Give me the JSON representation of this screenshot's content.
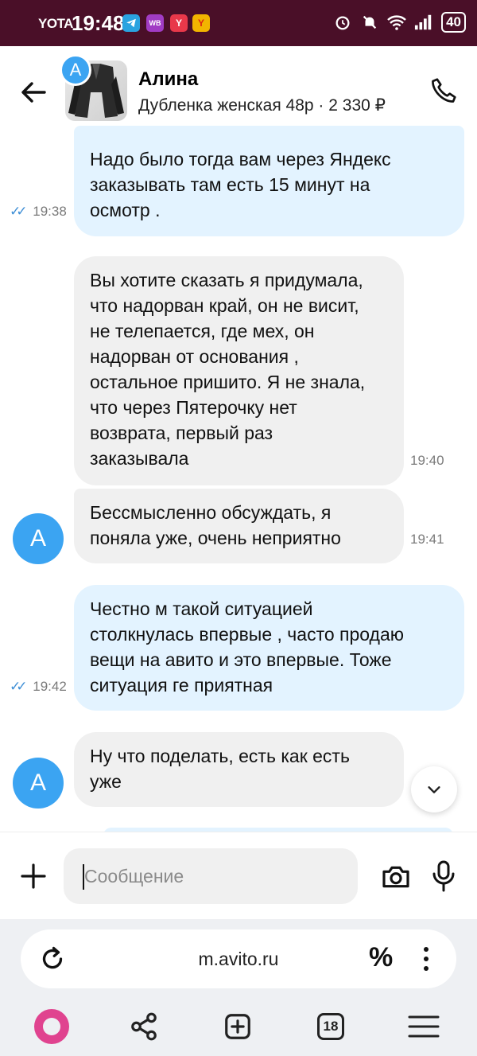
{
  "status_bar": {
    "carrier": "YOTA",
    "time": "19:48",
    "app_icons": [
      {
        "name": "telegram-icon",
        "label": "",
        "color": "#2aa3e0"
      },
      {
        "name": "wildberries-icon",
        "label": "WB",
        "color": "#a13cc4"
      },
      {
        "name": "yandex-icon",
        "label": "Y",
        "color": "#e8384a"
      },
      {
        "name": "yandex-market-icon",
        "label": "Y",
        "color": "#f2b400"
      }
    ],
    "battery": "40"
  },
  "header": {
    "contact_name": "Алина",
    "avatar_letter": "A",
    "item": "Дубленка женская 48р · 2 330 ₽"
  },
  "messages": [
    {
      "direction": "out",
      "lines": [
        "Надо было тогда вам через Яндекс",
        "заказывать там есть 15 минут на",
        "осмотр ."
      ],
      "time": "19:38",
      "read": true
    },
    {
      "direction": "in",
      "lines": [
        "Вы хотите сказать я придумала,",
        "что надорван край, он не висит,",
        "не телепается, где мех, он",
        "надорван от основания ,",
        "остальное пришито. Я не знала,",
        "что через Пятерочку нет",
        "возврата, первый раз",
        "заказывала"
      ],
      "time": "19:40"
    },
    {
      "direction": "in",
      "lines": [
        "Бессмысленно обсуждать, я",
        "поняла уже, очень неприятно"
      ],
      "time": "19:41",
      "avatar_letter": "A"
    },
    {
      "direction": "out",
      "lines": [
        "Честно м такой ситуацией",
        "столкнулась впервые , часто продаю",
        "вещи на авито и это впервые. Тоже",
        "ситуация ге приятная"
      ],
      "time": "19:42",
      "read": true
    },
    {
      "direction": "in",
      "lines": [
        "Ну что поделать, есть как есть",
        "уже"
      ],
      "time": "",
      "avatar_letter": "A"
    }
  ],
  "composer": {
    "placeholder": "Сообщение"
  },
  "browser": {
    "url": "m.avito.ru",
    "percent": "%",
    "tabs_count": "18"
  },
  "colors": {
    "status_bar": "#4a0f28",
    "outgoing_bubble": "#e3f3ff",
    "incoming_bubble": "#f0f0f0",
    "avatar": "#3ba4f2",
    "read_ticks": "#3f8fd6",
    "alice": "#e0438f"
  }
}
